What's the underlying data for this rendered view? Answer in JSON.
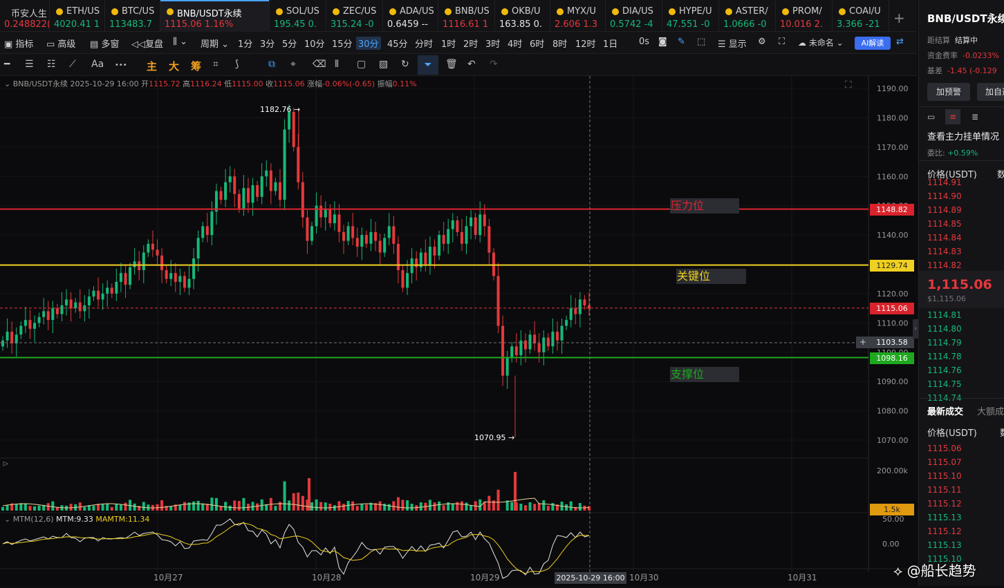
{
  "tabs": [
    {
      "name": "币安人生",
      "price": "0.248822(",
      "cls": "red",
      "left": 0,
      "width": 72,
      "dot": false
    },
    {
      "name": "ETH/US",
      "price": "4020.41  1",
      "cls": "green",
      "left": 72,
      "width": 80,
      "dot": true
    },
    {
      "name": "BTC/US",
      "price": "113483.7",
      "cls": "green",
      "left": 152,
      "width": 80,
      "dot": true
    },
    {
      "name": "BNB/USDT永续",
      "price": "1115.06  1.16%",
      "cls": "red",
      "left": 232,
      "width": 158,
      "dot": true,
      "active": true
    },
    {
      "name": "SOL/US",
      "price": "195.45  0.",
      "cls": "green",
      "left": 390,
      "width": 82,
      "dot": true
    },
    {
      "name": "ZEC/US",
      "price": "315.24  -0",
      "cls": "green",
      "left": 472,
      "width": 82,
      "dot": true
    },
    {
      "name": "ADA/US",
      "price": "0.6459  --",
      "cls": "white",
      "left": 554,
      "width": 80,
      "dot": true
    },
    {
      "name": "BNB/US",
      "price": "1116.61  1",
      "cls": "red",
      "left": 634,
      "width": 82,
      "dot": true
    },
    {
      "name": "OKB/U",
      "price": "163.85  0.",
      "cls": "white",
      "left": 716,
      "width": 80,
      "dot": true
    },
    {
      "name": "MYX/U",
      "price": "2.606  1.3",
      "cls": "red",
      "left": 796,
      "width": 80,
      "dot": true
    },
    {
      "name": "DIA/US",
      "price": "0.5742  -4",
      "cls": "green",
      "left": 876,
      "width": 82,
      "dot": true
    },
    {
      "name": "HYPE/U",
      "price": "47.551  -0",
      "cls": "green",
      "left": 958,
      "width": 82,
      "dot": true
    },
    {
      "name": "ASTER/",
      "price": "1.0666  -0",
      "cls": "green",
      "left": 1040,
      "width": 82,
      "dot": true
    },
    {
      "name": "PROM/",
      "price": "10.016  2.",
      "cls": "red",
      "left": 1122,
      "width": 82,
      "dot": true
    },
    {
      "name": "COAI/U",
      "price": "3.366  -21",
      "cls": "green",
      "left": 1204,
      "width": 82,
      "dot": true
    }
  ],
  "toolbar": {
    "indicator": "指标",
    "advanced": "高级",
    "multi": "多窗",
    "replay": "复盘",
    "period": "周期",
    "display": "显示",
    "unnamed": "未命名",
    "ai": "AI解读",
    "zero_s": "0s",
    "periods": [
      "1分",
      "3分",
      "5分",
      "10分",
      "15分",
      "30分",
      "45分",
      "分时",
      "1时",
      "2时",
      "3时",
      "4时",
      "6时",
      "8时",
      "12时",
      "1日"
    ],
    "selected": "30分"
  },
  "toolbar2": {
    "aa": "Aa",
    "dots": "•••",
    "main": "主",
    "big": "大",
    "chip": "筹"
  },
  "legend": {
    "symbol": "BNB/USDT永续",
    "date": "2025-10-29 16:00",
    "open_l": "开",
    "open": "1115.72",
    "high_l": "高",
    "high": "1116.24",
    "low_l": "低",
    "low": "1115.00",
    "close_l": "收",
    "close": "1115.06",
    "chg_l": "涨幅",
    "chg": "-0.06%(-0.65)",
    "amp_l": "振幅",
    "amp": "0.11%"
  },
  "levels": {
    "resist": "压力位",
    "key": "关键位",
    "support": "支撑位"
  },
  "price_labels": {
    "resist": "1148.82",
    "key": "1129.74",
    "last": "1115.06",
    "cross": "1103.58",
    "support": "1098.16",
    "vol": "1.5k"
  },
  "annotations": {
    "high": "1182.76",
    "low": "1070.95"
  },
  "y_ticks": [
    "1190.00",
    "1180.00",
    "1170.00",
    "1160.00",
    "1150.00",
    "1140.00",
    "1130.00",
    "1120.00",
    "1110.00",
    "1100.00",
    "1090.00",
    "1080.00",
    "1070.00"
  ],
  "vol_tick": "200.00k",
  "mtm": {
    "label": "MTM(12,6)",
    "v": "MTM:9.33",
    "ma": "MAMTM:11.34",
    "t1": "50.00",
    "t2": "0.00"
  },
  "x_labels": [
    "10月27",
    "10月28",
    "10月29",
    "10月30",
    "10月31"
  ],
  "cursor_time": "2025-10-29 16:00",
  "right": {
    "title": "BNB/USDT永续",
    "settle_l": "距结算",
    "settle": "结算中",
    "fund_l": "资金费率",
    "fund": "-0.0233%",
    "basis_l": "基差",
    "basis": "-1.45 (-0.129",
    "alert": "加预警",
    "fav": "加自选",
    "mainorder": "查看主力挂单情况",
    "ratio_l": "委比:",
    "ratio": "+0.59%",
    "price_h": "价格(USDT)",
    "qty_h": "数",
    "asks": [
      "1114.91",
      "1114.90",
      "1114.89",
      "1114.85",
      "1114.84",
      "1114.83",
      "1114.82"
    ],
    "last": "1,115.06",
    "last_usd": "$1,115.06",
    "bids": [
      "1114.81",
      "1114.80",
      "1114.79",
      "1114.78",
      "1114.76",
      "1114.75",
      "1114.74"
    ],
    "trades_h": "最新成交",
    "big_h": "大额成",
    "trades": [
      {
        "p": "1115.06",
        "c": "red"
      },
      {
        "p": "1115.07",
        "c": "red"
      },
      {
        "p": "1115.10",
        "c": "red"
      },
      {
        "p": "1115.11",
        "c": "red"
      },
      {
        "p": "1115.12",
        "c": "red"
      },
      {
        "p": "1115.13",
        "c": "green"
      },
      {
        "p": "1115.12",
        "c": "red"
      },
      {
        "p": "1115.13",
        "c": "green"
      },
      {
        "p": "1115.10",
        "c": "green"
      }
    ]
  },
  "watermark": "@船长趋势",
  "colors": {
    "up": "#16b979",
    "down": "#e4393c",
    "resist": "#e0242f",
    "key": "#f0d020",
    "support": "#1fa81f"
  },
  "chart_data": {
    "type": "candlestick",
    "interval": "30分",
    "ylim": [
      1065,
      1192
    ],
    "closes": [
      1104,
      1107,
      1103,
      1106,
      1109,
      1111,
      1108,
      1110,
      1112,
      1114,
      1111,
      1115,
      1113,
      1116,
      1118,
      1115,
      1117,
      1114,
      1116,
      1119,
      1121,
      1118,
      1120,
      1122,
      1120,
      1124,
      1127,
      1123,
      1129,
      1131,
      1128,
      1134,
      1137,
      1135,
      1133,
      1128,
      1125,
      1127,
      1124,
      1126,
      1122,
      1125,
      1132,
      1139,
      1143,
      1140,
      1148,
      1155,
      1152,
      1158,
      1160,
      1154,
      1149,
      1156,
      1151,
      1157,
      1153,
      1160,
      1162,
      1155,
      1158,
      1152,
      1176,
      1182,
      1170,
      1158,
      1146,
      1138,
      1143,
      1150,
      1146,
      1149,
      1144,
      1147,
      1141,
      1138,
      1143,
      1139,
      1136,
      1140,
      1137,
      1141,
      1138,
      1134,
      1139,
      1143,
      1137,
      1128,
      1122,
      1127,
      1132,
      1129,
      1134,
      1130,
      1136,
      1133,
      1140,
      1137,
      1142,
      1145,
      1141,
      1137,
      1143,
      1146,
      1140,
      1147,
      1143,
      1134,
      1126,
      1109,
      1092,
      1098,
      1102,
      1099,
      1104,
      1101,
      1106,
      1103,
      1100,
      1105,
      1102,
      1107,
      1104,
      1109,
      1111,
      1115,
      1113,
      1118,
      1116,
      1115
    ],
    "annotations": {
      "high": 1182.76,
      "low": 1070.95
    },
    "hlines": {
      "resist": 1148.82,
      "key": 1129.74,
      "last": 1115.06,
      "support": 1098.16
    }
  }
}
